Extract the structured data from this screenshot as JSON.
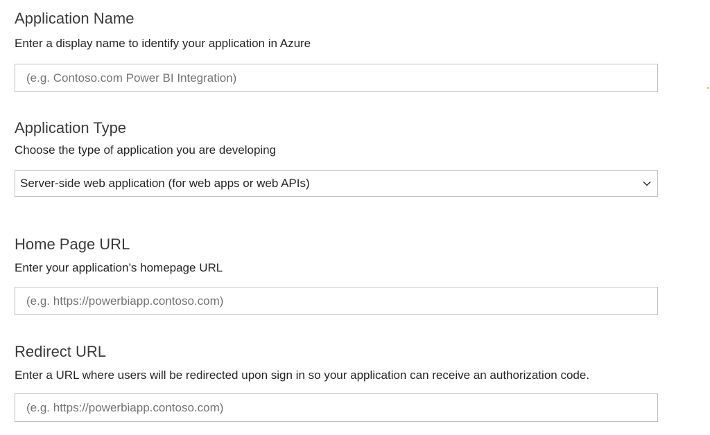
{
  "app_name": {
    "heading": "Application Name",
    "description": "Enter a display name to identify your application in Azure",
    "placeholder": "(e.g. Contoso.com Power BI Integration)",
    "value": ""
  },
  "app_type": {
    "heading": "Application Type",
    "description": "Choose the type of application you are developing",
    "selected": "Server-side web application (for web apps or web APIs)",
    "icon": "chevron-down-icon"
  },
  "home_page": {
    "heading": "Home Page URL",
    "description": "Enter your application’s homepage URL",
    "placeholder": "(e.g. https://powerbiapp.contoso.com)",
    "value": ""
  },
  "redirect": {
    "heading": "Redirect URL",
    "description": "Enter a URL where users will be redirected upon sign in so your application can receive an authorization code.",
    "placeholder": "(e.g. https://powerbiapp.contoso.com)",
    "value": ""
  }
}
